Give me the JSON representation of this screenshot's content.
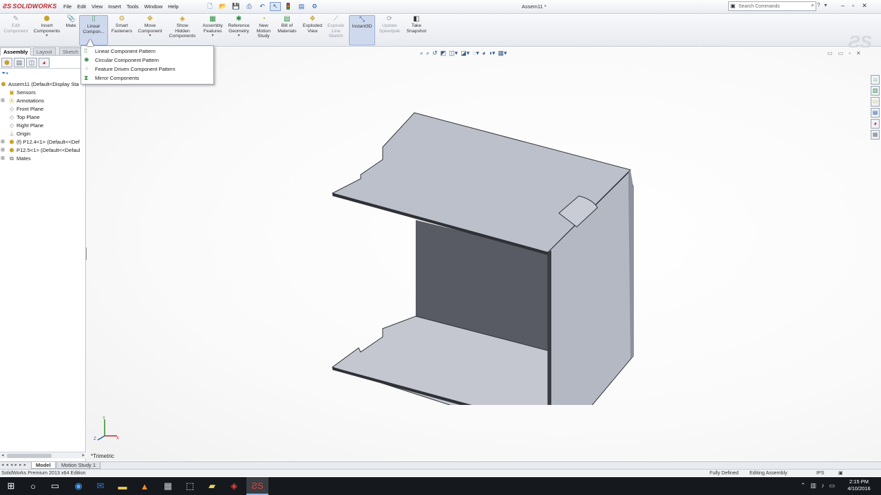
{
  "titlebar": {
    "app_name": "SOLIDWORKS",
    "menus": [
      "File",
      "Edit",
      "View",
      "Insert",
      "Tools",
      "Window",
      "Help"
    ],
    "document_title": "Assem11 *",
    "search_placeholder": "Search Commands",
    "help_icons": [
      "?",
      "▾"
    ],
    "window_controls": [
      "–",
      "▫",
      "✕"
    ]
  },
  "commands": {
    "edit_component": "Edit\nComponent",
    "insert_components": "Insert\nComponents",
    "mate": "Mate",
    "linear_component": "Linear\nCompon...",
    "smart_fasteners": "Smart\nFasteners",
    "move_component": "Move\nComponent",
    "show_hidden": "Show\nHidden\nComponents",
    "assembly_features": "Assembly\nFeatures",
    "reference_geometry": "Reference\nGeometry",
    "new_motion_study": "New\nMotion\nStudy",
    "bill_of_materials": "Bill of\nMaterials",
    "exploded_view": "Exploded\nView",
    "explode_line_sketch": "Explode\nLine\nSketch",
    "instant3d": "Instant3D",
    "update_speedpak": "Update\nSpeedpak",
    "take_snapshot": "Take\nSnapshot"
  },
  "command_tabs": [
    "Assembly",
    "Layout",
    "Sketch"
  ],
  "dropdown": {
    "items": [
      "Linear Component Pattern",
      "Circular Component Pattern",
      "Feature Driven Component Pattern",
      "Mirror Components"
    ]
  },
  "tree": {
    "root": "Assem11  (Default<Display Sta",
    "items": [
      {
        "label": "Sensors"
      },
      {
        "label": "Annotations"
      },
      {
        "label": "Front Plane"
      },
      {
        "label": "Top Plane"
      },
      {
        "label": "Right Plane"
      },
      {
        "label": "Origin"
      },
      {
        "label": "(f) P12.4<1> (Default<<Def"
      },
      {
        "label": "P12.5<1> (Default<<Defaul"
      },
      {
        "label": "Mates"
      }
    ]
  },
  "viewport": {
    "view_name": "*Trimetric",
    "triad": {
      "x": "X",
      "y": "Y",
      "z": "Z"
    }
  },
  "bottom_tabs": [
    "Model",
    "Motion Study 1"
  ],
  "status": {
    "edition": "SolidWorks Premium 2013 x64 Edition",
    "defined": "Fully Defined",
    "editing": "Editing Assembly",
    "units": "IPS"
  },
  "taskbar": {
    "time": "2:15 PM",
    "date": "4/10/2016"
  },
  "colors": {
    "accent_red": "#c0262d",
    "part_light": "#bcc0cb",
    "part_dark": "#5b5e66"
  }
}
